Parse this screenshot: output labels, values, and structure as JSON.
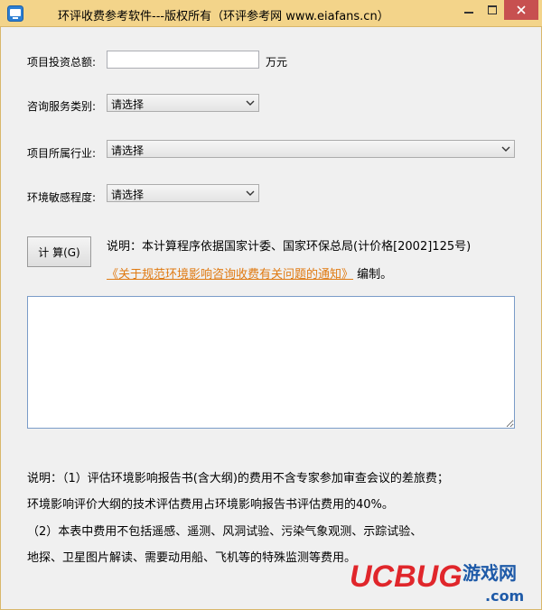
{
  "window": {
    "title": "环评收费参考软件---版权所有（环评参考网 www.eiafans.cn）"
  },
  "form": {
    "investment_label": "项目投资总额:",
    "investment_value": "",
    "investment_unit": "万元",
    "service_label": "咨询服务类别:",
    "service_value": "请选择",
    "industry_label": "项目所属行业:",
    "industry_value": "请选择",
    "sensitivity_label": "环境敏感程度:",
    "sensitivity_value": "请选择"
  },
  "actions": {
    "calc_label": "计 算(G)"
  },
  "notes": {
    "line1": "说明：本计算程序依据国家计委、国家环保总局(计价格[2002]125号)",
    "link_text": "《关于规范环境影响咨询收费有关问题的通知》",
    "line2_suffix": " 编制。"
  },
  "output": {
    "text": ""
  },
  "footer": {
    "line1": "说明：（1）评估环境影响报告书(含大纲)的费用不含专家参加审查会议的差旅费；",
    "line2": "环境影响评价大纲的技术评估费用占环境影响报告书评估费用的40%。",
    "line3": "（2）本表中费用不包括遥感、遥测、风洞试验、污染气象观测、示踪试验、",
    "line4": "地探、卫星图片解读、需要动用船、飞机等的特殊监测等费用。"
  },
  "watermark": {
    "brand": "UCBUG",
    "cn": "游戏网",
    "domain": ".com"
  },
  "colors": {
    "titlebar": "#f3d48a",
    "link": "#e07a12",
    "close": "#c75050",
    "watermark_red": "#e0262b",
    "watermark_blue": "#1e5aa8"
  }
}
